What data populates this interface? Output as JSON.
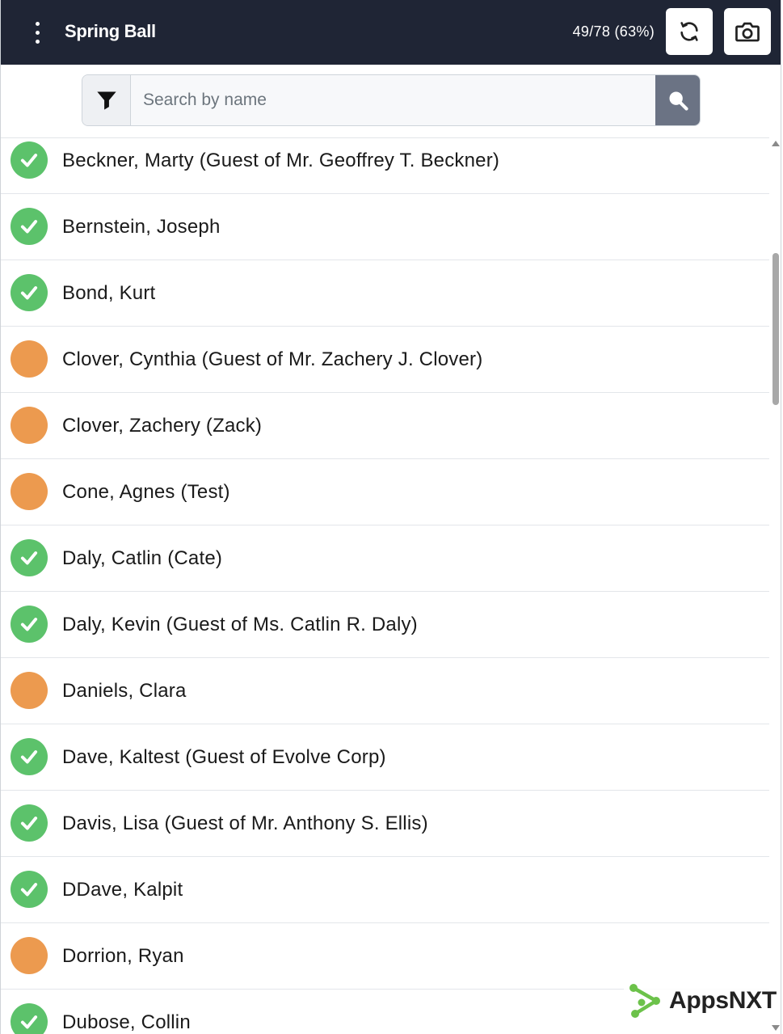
{
  "header": {
    "title": "Spring Ball",
    "progress": "49/78 (63%)",
    "menu_icon": "kebab-menu-icon",
    "refresh_icon": "refresh-icon",
    "camera_icon": "camera-icon"
  },
  "search": {
    "placeholder": "Search by name",
    "value": "",
    "filter_icon": "filter-icon",
    "search_icon": "search-icon"
  },
  "colors": {
    "header_bg": "#1f2535",
    "checked_in": "#5cc26b",
    "pending": "#ec9a4f",
    "search_button": "#6b7384"
  },
  "attendees": [
    {
      "name": "Beckner, Marty (Guest of Mr. Geoffrey T. Beckner)",
      "status": "checked-in"
    },
    {
      "name": "Bernstein, Joseph",
      "status": "checked-in"
    },
    {
      "name": "Bond, Kurt",
      "status": "checked-in"
    },
    {
      "name": "Clover, Cynthia (Guest of Mr. Zachery J. Clover)",
      "status": "pending"
    },
    {
      "name": "Clover, Zachery (Zack)",
      "status": "pending"
    },
    {
      "name": "Cone, Agnes (Test)",
      "status": "pending"
    },
    {
      "name": "Daly, Catlin (Cate)",
      "status": "checked-in"
    },
    {
      "name": "Daly, Kevin (Guest of Ms. Catlin R. Daly)",
      "status": "checked-in"
    },
    {
      "name": "Daniels, Clara",
      "status": "pending"
    },
    {
      "name": "Dave, Kaltest (Guest of Evolve Corp)",
      "status": "checked-in"
    },
    {
      "name": "Davis, Lisa (Guest of Mr. Anthony S. Ellis)",
      "status": "checked-in"
    },
    {
      "name": "DDave, Kalpit",
      "status": "checked-in"
    },
    {
      "name": "Dorrion, Ryan",
      "status": "pending"
    },
    {
      "name": "Dubose, Collin",
      "status": "checked-in"
    }
  ],
  "brand": {
    "name": "AppsNXT",
    "logo_icon": "appsnxt-logo-icon"
  }
}
